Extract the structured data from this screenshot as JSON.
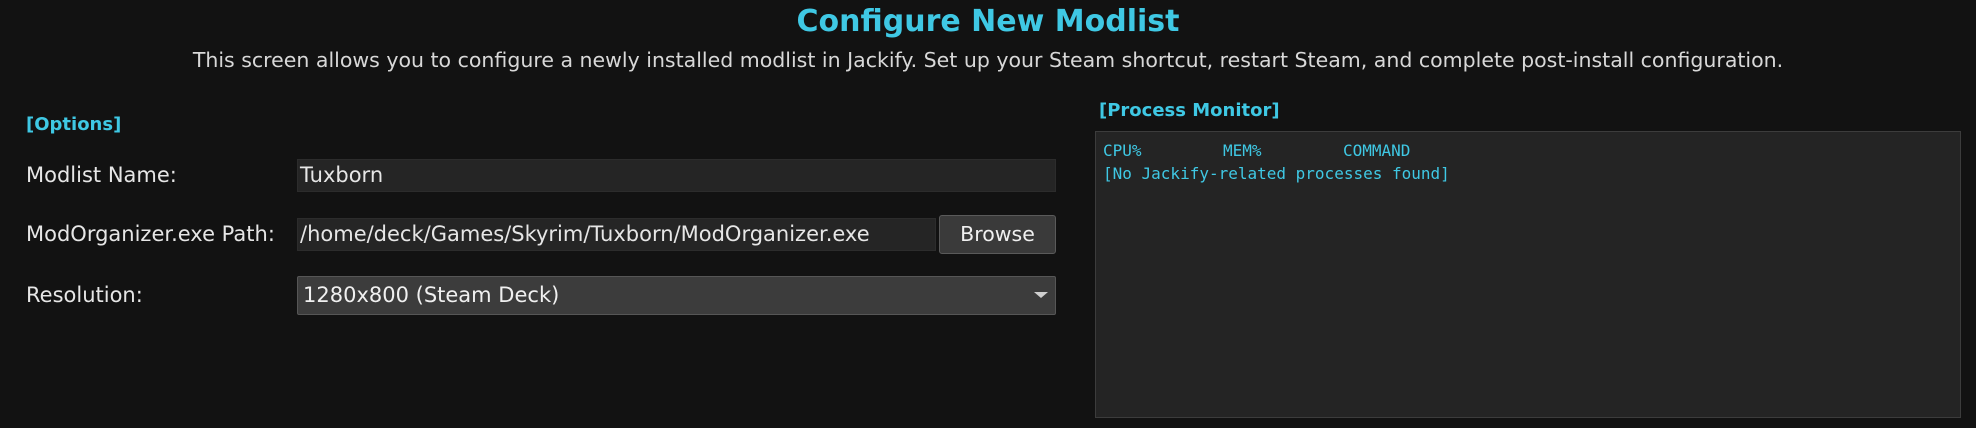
{
  "header": {
    "title": "Configure New Modlist",
    "description": "This screen allows you to configure a newly installed modlist in Jackify. Set up your Steam shortcut, restart Steam, and complete post-install configuration."
  },
  "options": {
    "section_label": "[Options]",
    "modlist_name": {
      "label": "Modlist Name:",
      "value": "Tuxborn"
    },
    "mo_path": {
      "label": "ModOrganizer.exe Path:",
      "value": "/home/deck/Games/Skyrim/Tuxborn/ModOrganizer.exe",
      "browse_label": "Browse"
    },
    "resolution": {
      "label": "Resolution:",
      "selected": "1280x800 (Steam Deck)"
    }
  },
  "process_monitor": {
    "section_label": "[Process Monitor]",
    "columns": [
      "CPU%",
      "MEM%",
      "COMMAND"
    ],
    "message": "[No Jackify-related processes found]"
  },
  "colors": {
    "accent": "#3fc8e4",
    "background": "#121212",
    "field_background": "#252525"
  },
  "icons": {
    "dropdown": "chevron-down-icon"
  }
}
